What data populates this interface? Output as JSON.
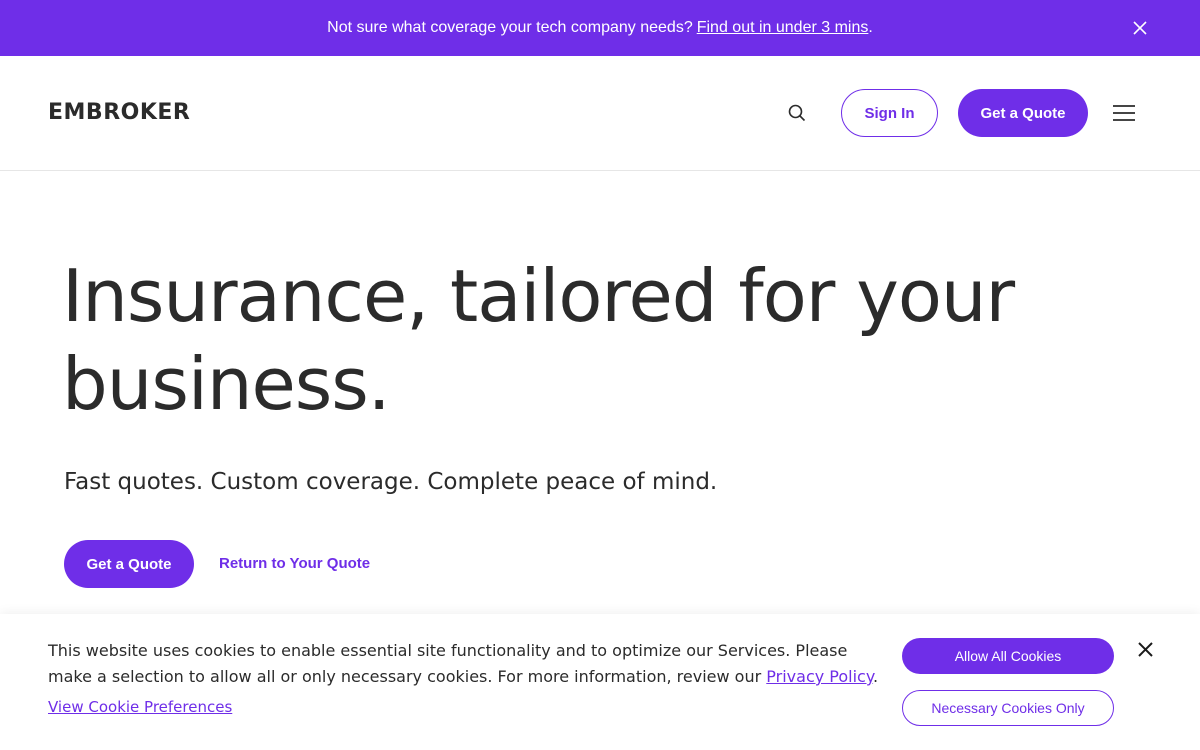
{
  "colors": {
    "brand": "#6f2ee8",
    "text": "#2b2b2b",
    "background": "#ffffff"
  },
  "promo": {
    "text": "Not sure what coverage your tech company needs?",
    "link": "Find out in under 3 mins",
    "suffix": ".",
    "close_icon": "close-icon"
  },
  "header": {
    "logo": "EMBROKER",
    "search_icon": "search-icon",
    "sign_in": "Sign In",
    "get_quote": "Get a Quote",
    "menu_icon": "hamburger-menu-icon"
  },
  "hero": {
    "title_line1": "Insurance, tailored for your",
    "title_line2": "business.",
    "subtitle": "Fast quotes. Custom coverage. Complete peace of mind.",
    "get_quote": "Get a Quote",
    "return_link": "Return to Your Quote"
  },
  "cookie": {
    "text": "This website uses cookies to enable essential site functionality and to optimize our Services. Please make a selection to allow all or only necessary cookies. For more information, review our",
    "policy_link": "Privacy Policy",
    "suffix": ".",
    "preferences_link": "View Cookie Preferences",
    "allow_all": "Allow All Cookies",
    "necessary_only": "Necessary Cookies Only",
    "close_icon": "close-icon"
  }
}
